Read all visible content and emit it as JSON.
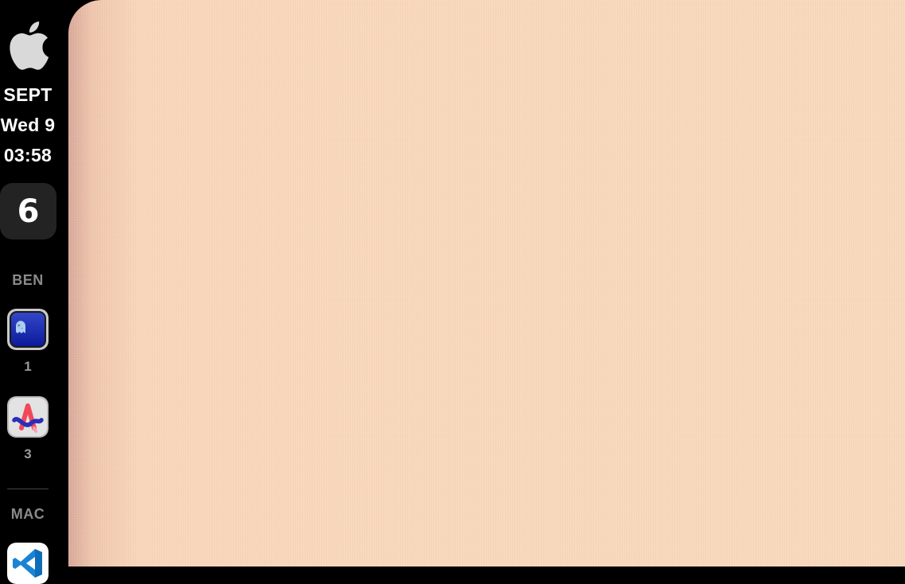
{
  "sidebar": {
    "date": {
      "month": "SEPT",
      "day": "Wed 9",
      "time": "03:58"
    },
    "workspace_badge": "6",
    "sections": [
      {
        "label": "BEN",
        "apps": [
          {
            "icon": "terminal-ghost-icon",
            "count": "1"
          },
          {
            "icon": "arc-browser-icon",
            "count": "3"
          }
        ]
      },
      {
        "label": "MAC",
        "apps": [
          {
            "icon": "vscode-icon"
          }
        ]
      }
    ]
  },
  "colors": {
    "sidebar_bg": "#000000",
    "desktop_bg": "#f9d9bc",
    "label_gray": "#8a8a8a",
    "badge_bg": "#232323"
  }
}
